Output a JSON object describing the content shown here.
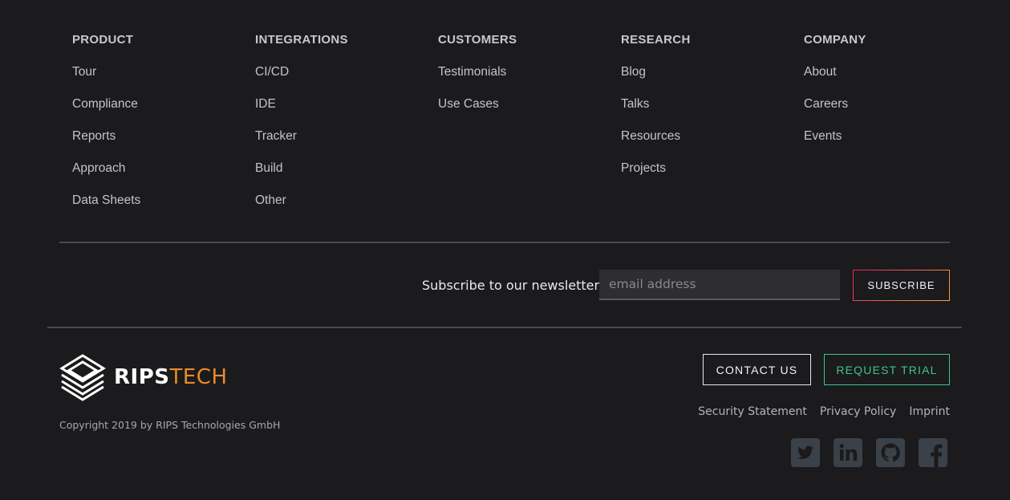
{
  "columns": [
    {
      "heading": "PRODUCT",
      "links": [
        "Tour",
        "Compliance",
        "Reports",
        "Approach",
        "Data Sheets"
      ]
    },
    {
      "heading": "INTEGRATIONS",
      "links": [
        "CI/CD",
        "IDE",
        "Tracker",
        "Build",
        "Other"
      ]
    },
    {
      "heading": "CUSTOMERS",
      "links": [
        "Testimonials",
        "Use Cases"
      ]
    },
    {
      "heading": "RESEARCH",
      "links": [
        "Blog",
        "Talks",
        "Resources",
        "Projects"
      ]
    },
    {
      "heading": "COMPANY",
      "links": [
        "About",
        "Careers",
        "Events"
      ]
    }
  ],
  "newsletter": {
    "label": "Subscribe to our newsletter",
    "placeholder": "email address",
    "button": "SUBSCRIBE"
  },
  "brand": {
    "name_bold": "RIPS",
    "name_light": "TECH",
    "copyright": "Copyright 2019 by RIPS Technologies GmbH",
    "accent": "#e98b2a"
  },
  "actions": {
    "contact": "CONTACT US",
    "trial": "REQUEST TRIAL",
    "trial_color": "#3fc58a"
  },
  "legal_links": [
    "Security Statement",
    "Privacy Policy",
    "Imprint"
  ],
  "social": [
    "twitter-icon",
    "linkedin-icon",
    "github-icon",
    "facebook-icon"
  ],
  "colors": {
    "background": "#1b1a1d",
    "social_icon": "#3a4149"
  }
}
